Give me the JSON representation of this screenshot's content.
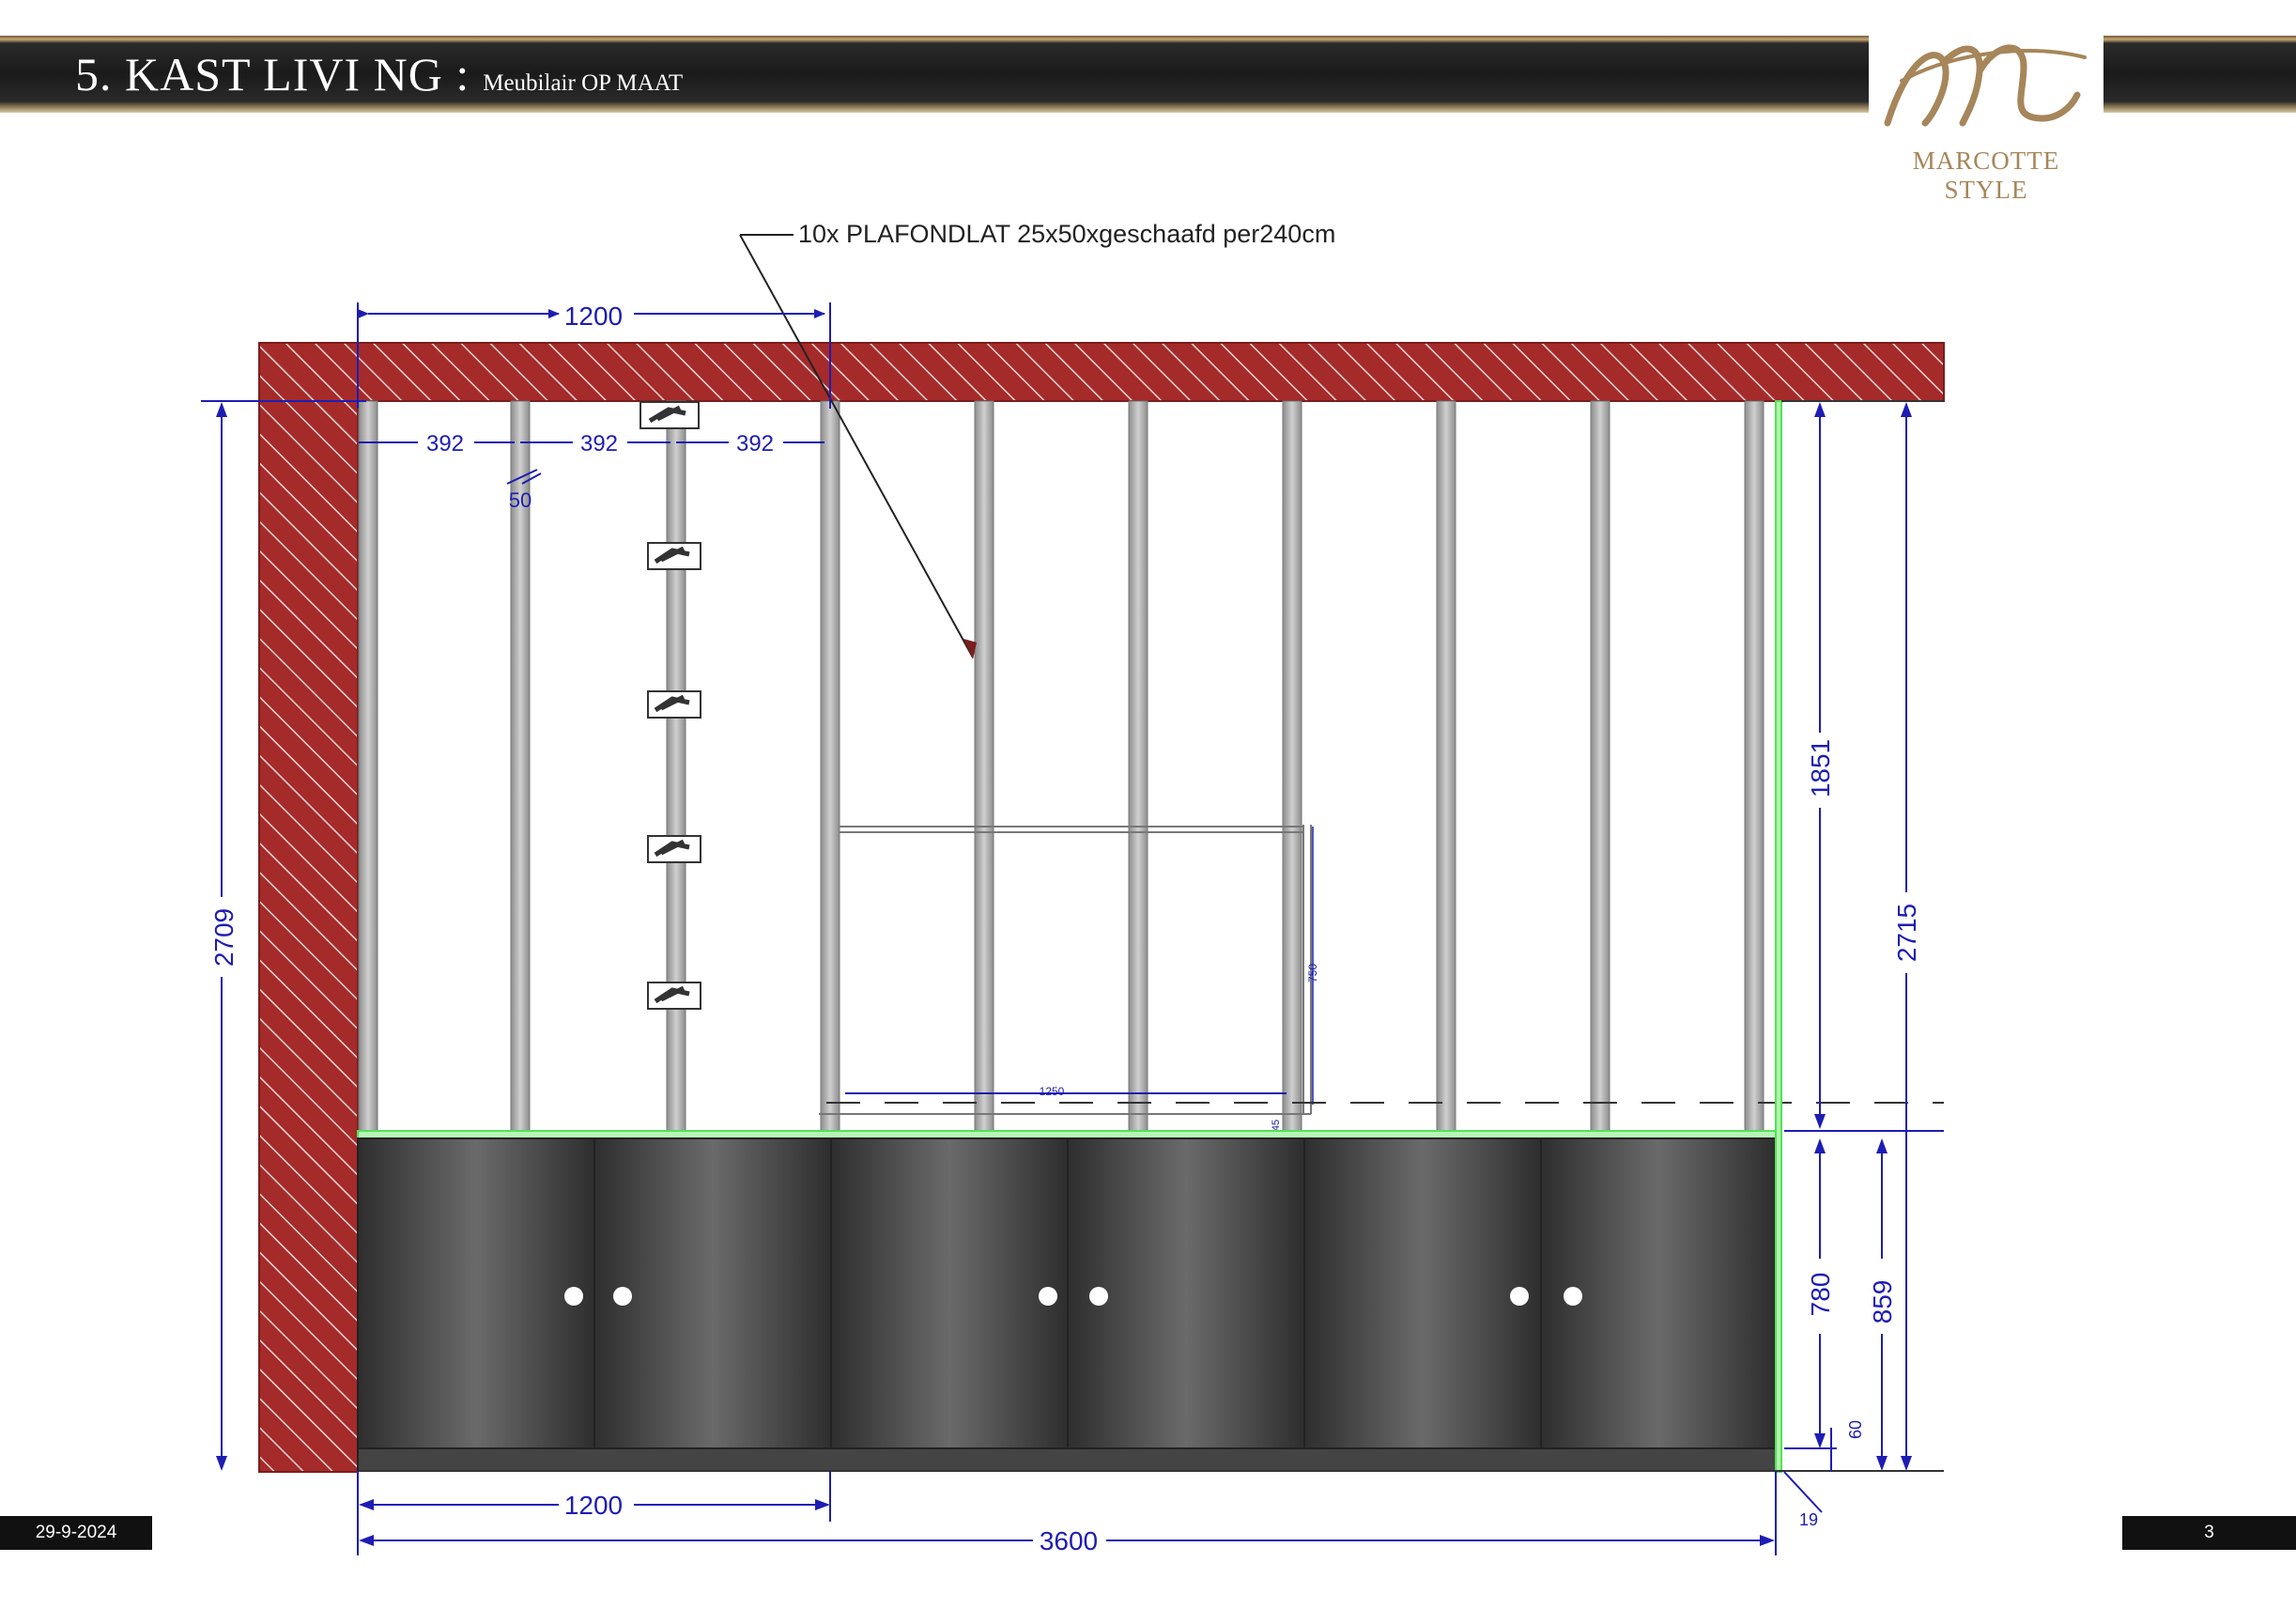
{
  "header": {
    "title": "5. KAST  LIVI NG :",
    "subtitle": "Meubilair OP MAAT"
  },
  "logo": {
    "brand": "MARCOTTE STYLE"
  },
  "footer": {
    "date": "29-9-2024",
    "page": "3"
  },
  "drawing": {
    "callout": "10x PLAFONDLAT 25x50xgeschaafd per240cm",
    "dims": {
      "top_1200": "1200",
      "spacing_1": "392",
      "spacing_2": "392",
      "spacing_3": "392",
      "lat_width": "50",
      "left_height": "2709",
      "right_upper": "1851",
      "right_total": "2715",
      "cabinet_780": "780",
      "cabinet_859": "859",
      "plinth_60": "60",
      "side_19": "19",
      "bottom_1200": "1200",
      "total_3600": "3600",
      "small_1250": "1250",
      "small_750": "750",
      "small_45": "45"
    }
  },
  "colors": {
    "wall_hatch": "#a52a2a",
    "dimension": "#1d1db3",
    "cabinet_outline": "#66ff66",
    "cabinet_dark": "#333333",
    "brand_gold": "#a6865a"
  }
}
